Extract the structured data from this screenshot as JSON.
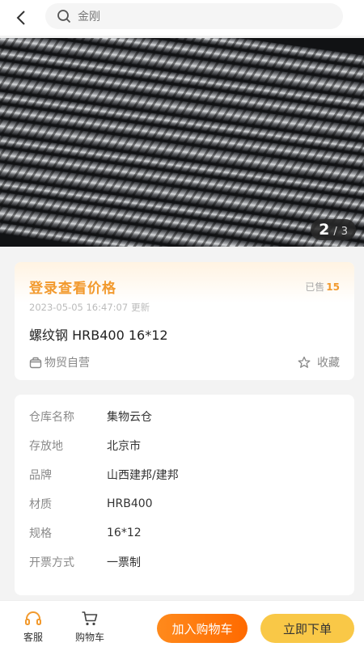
{
  "header": {
    "search_text": "金刚"
  },
  "gallery": {
    "current": "2",
    "separator": "/",
    "total": "3"
  },
  "product": {
    "price_login": "登录查看价格",
    "sold_label": "已售",
    "sold_count": "15",
    "updated_time": "2023-05-05 16:47:07",
    "updated_suffix": "更新",
    "title": "螺纹钢 HRB400 16*12",
    "seller": "物贸自营",
    "favorite": "收藏"
  },
  "specs": [
    {
      "key": "仓库名称",
      "value": "集物云仓"
    },
    {
      "key": "存放地",
      "value": "北京市"
    },
    {
      "key": "品牌",
      "value": "山西建邦/建邦"
    },
    {
      "key": "材质",
      "value": "HRB400"
    },
    {
      "key": "规格",
      "value": "16*12"
    },
    {
      "key": "开票方式",
      "value": "一票制"
    }
  ],
  "bottom_bar": {
    "service": "客服",
    "cart": "购物车",
    "add_to_cart": "加入购物车",
    "buy_now": "立即下单"
  },
  "colors": {
    "accent": "#f29a2e",
    "cart_button": "#ff7a10",
    "buy_button": "#f9c847"
  },
  "icons": {
    "back": "chevron-left-icon",
    "search": "search-icon",
    "seller": "store-icon",
    "favorite": "star-icon",
    "service": "headset-icon",
    "cart": "cart-icon"
  }
}
